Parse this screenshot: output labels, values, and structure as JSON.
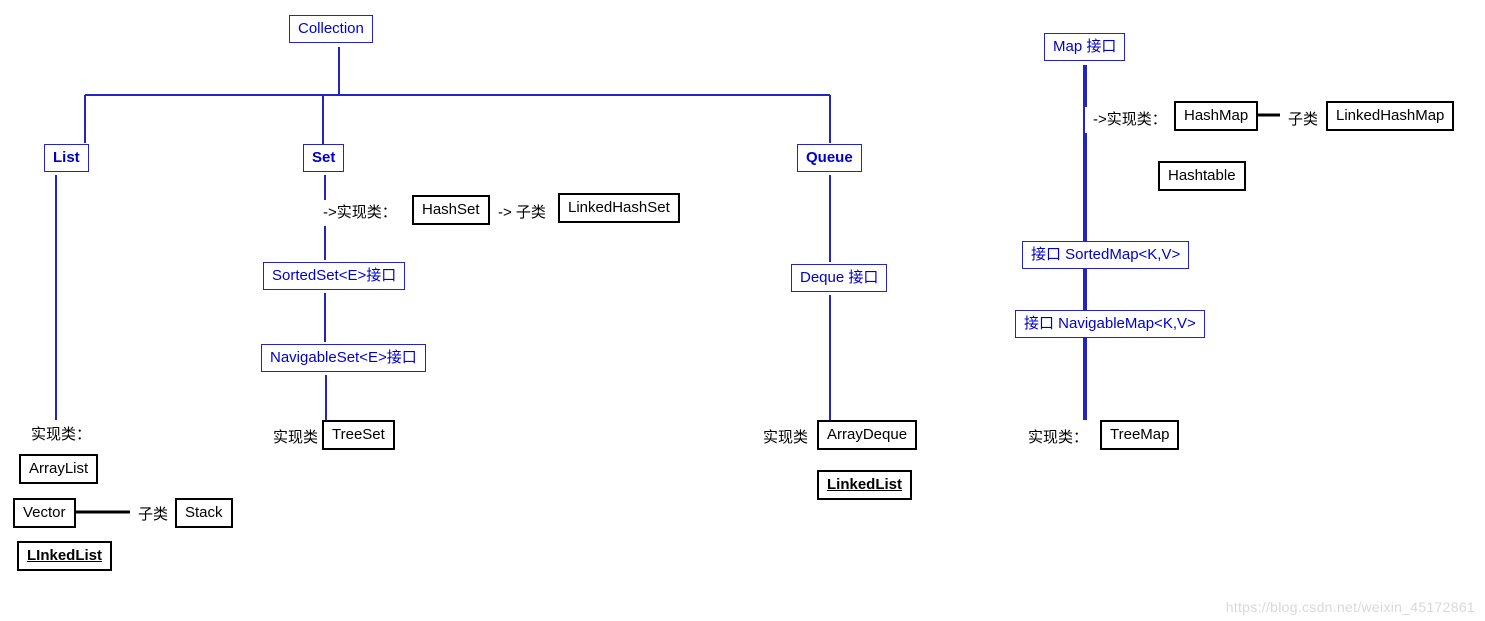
{
  "root": {
    "collection": "Collection",
    "map": "Map 接口"
  },
  "list": {
    "label": "List",
    "impl_label": "实现类：",
    "arraylist": "ArrayList",
    "vector": "Vector",
    "subclass_label": "子类",
    "stack": "Stack",
    "linkedlist": "LInkedList"
  },
  "set": {
    "label": "Set",
    "impl_arrow": "->实现类：",
    "hashset": "HashSet",
    "sub_arrow": "-> 子类",
    "linkedhashset": "LinkedHashSet",
    "sortedset": "SortedSet<E>接口",
    "navigableset": "NavigableSet<E>接口",
    "impl_label": "实现类",
    "treeset": "TreeSet"
  },
  "queue": {
    "label": "Queue",
    "deque": "Deque 接口",
    "impl_label": "实现类",
    "arraydeque": "ArrayDeque",
    "linkedlist": "LinkedList"
  },
  "map": {
    "impl_arrow": "->实现类：",
    "hashmap": "HashMap",
    "sub_label": "子类",
    "linkedhashmap": "LinkedHashMap",
    "hashtable": "Hashtable",
    "sortedmap": "接口 SortedMap<K,V>",
    "navigablemap": "接口  NavigableMap<K,V>",
    "impl_label": "实现类：",
    "treemap": "TreeMap"
  },
  "watermark": "https://blog.csdn.net/weixin_45172861"
}
